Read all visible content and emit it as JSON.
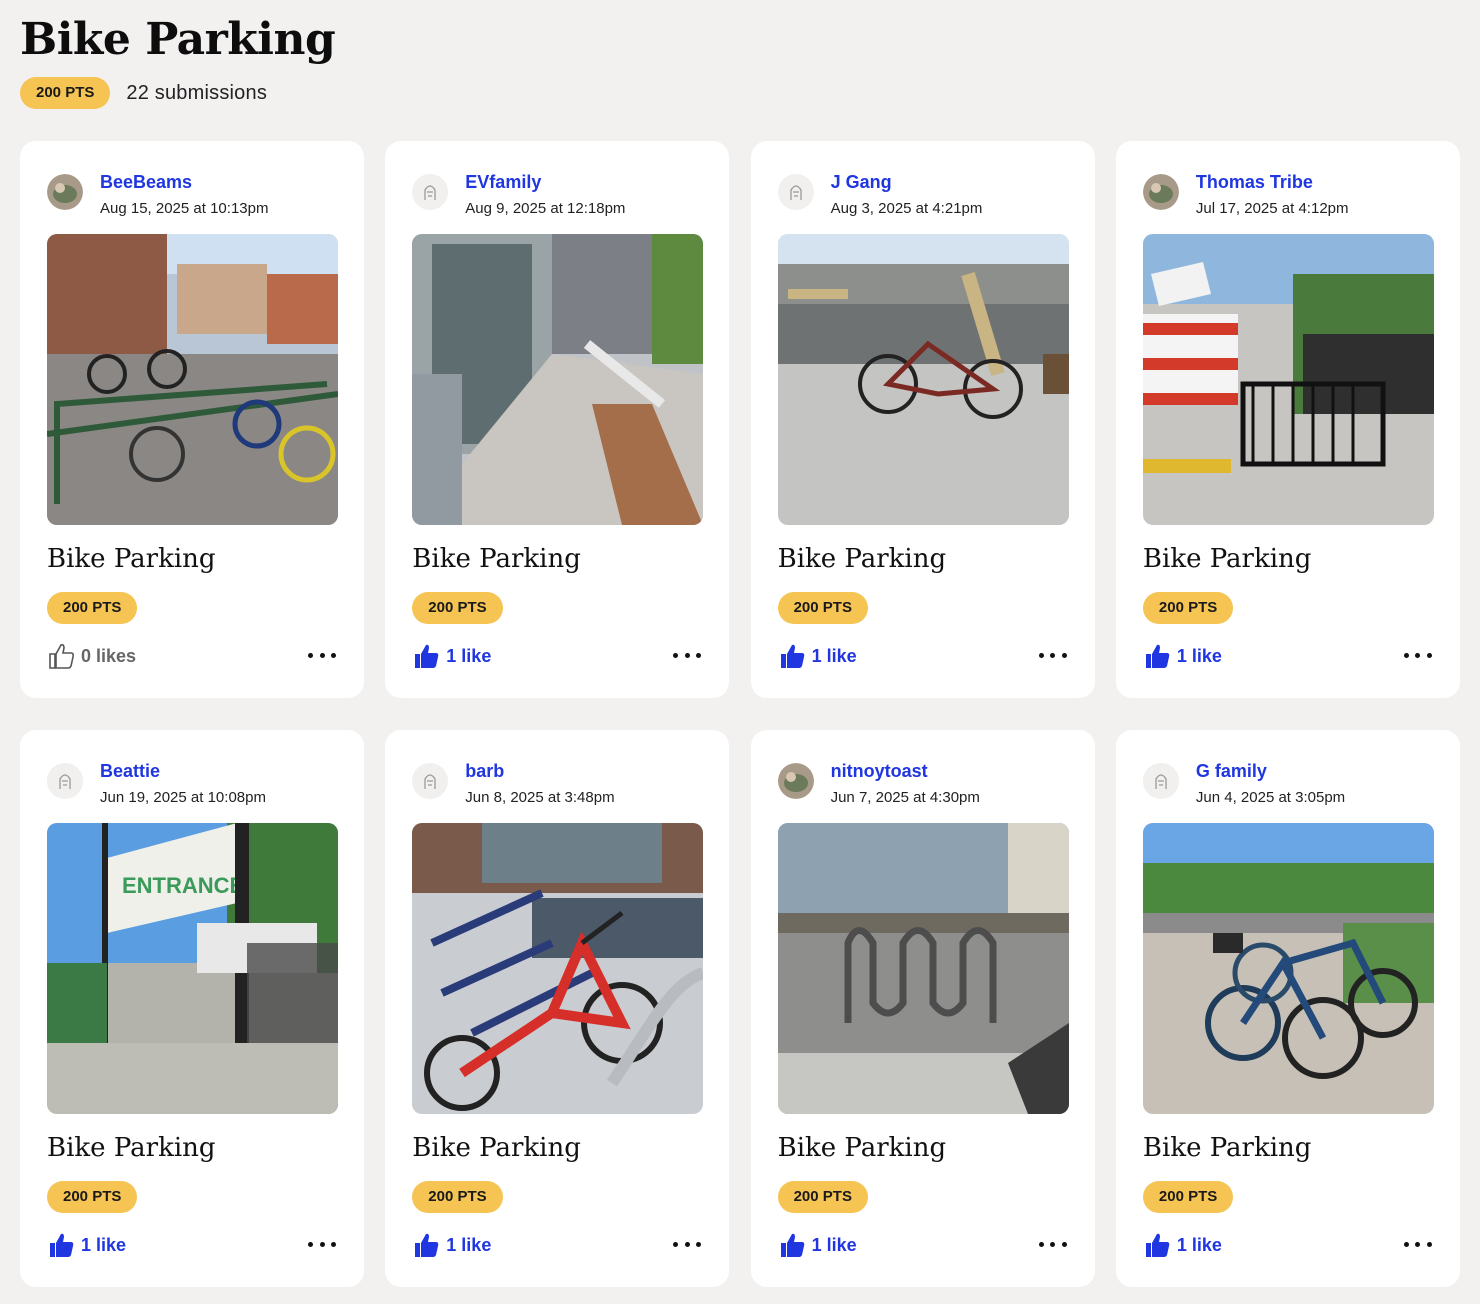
{
  "page": {
    "title": "Bike Parking",
    "points_badge": "200 PTS",
    "submission_count": "22 submissions"
  },
  "colors": {
    "background": "#f3f0f0",
    "accent_blue": "#1f36e0",
    "badge_yellow": "#f6c453"
  },
  "cards": [
    {
      "username": "BeeBeams",
      "timestamp": "Aug 15, 2025 at 10:13pm",
      "title": "Bike Parking",
      "points": "200 PTS",
      "likes_label": "0 likes",
      "liked": false,
      "avatar_icon": "user-photo-avatar",
      "photo_icon": "bike-rack-plaza-photo"
    },
    {
      "username": "EVfamily",
      "timestamp": "Aug 9, 2025 at 12:18pm",
      "title": "Bike Parking",
      "points": "200 PTS",
      "likes_label": "1 like",
      "liked": true,
      "avatar_icon": "default-avatar-icon",
      "photo_icon": "bike-rack-walkway-photo"
    },
    {
      "username": "J Gang",
      "timestamp": "Aug 3, 2025 at 4:21pm",
      "title": "Bike Parking",
      "points": "200 PTS",
      "likes_label": "1 like",
      "liked": true,
      "avatar_icon": "default-avatar-icon",
      "photo_icon": "bike-on-sidewalk-photo"
    },
    {
      "username": "Thomas Tribe",
      "timestamp": "Jul 17, 2025 at 4:12pm",
      "title": "Bike Parking",
      "points": "200 PTS",
      "likes_label": "1 like",
      "liked": true,
      "avatar_icon": "user-photo-avatar",
      "photo_icon": "black-bike-rack-photo"
    },
    {
      "username": "Beattie",
      "timestamp": "Jun 19, 2025 at 10:08pm",
      "title": "Bike Parking",
      "points": "200 PTS",
      "likes_label": "1 like",
      "liked": true,
      "avatar_icon": "default-avatar-icon",
      "photo_icon": "entrance-gate-photo"
    },
    {
      "username": "barb",
      "timestamp": "Jun 8, 2025 at 3:48pm",
      "title": "Bike Parking",
      "points": "200 PTS",
      "likes_label": "1 like",
      "liked": true,
      "avatar_icon": "default-avatar-icon",
      "photo_icon": "red-bike-rack-photo"
    },
    {
      "username": "nitnoytoast",
      "timestamp": "Jun 7, 2025 at 4:30pm",
      "title": "Bike Parking",
      "points": "200 PTS",
      "likes_label": "1 like",
      "liked": true,
      "avatar_icon": "user-photo-avatar",
      "photo_icon": "wave-bike-rack-photo"
    },
    {
      "username": "G family",
      "timestamp": "Jun 4, 2025 at 3:05pm",
      "title": "Bike Parking",
      "points": "200 PTS",
      "likes_label": "1 like",
      "liked": true,
      "avatar_icon": "default-avatar-icon",
      "photo_icon": "parked-bikes-lot-photo"
    }
  ]
}
